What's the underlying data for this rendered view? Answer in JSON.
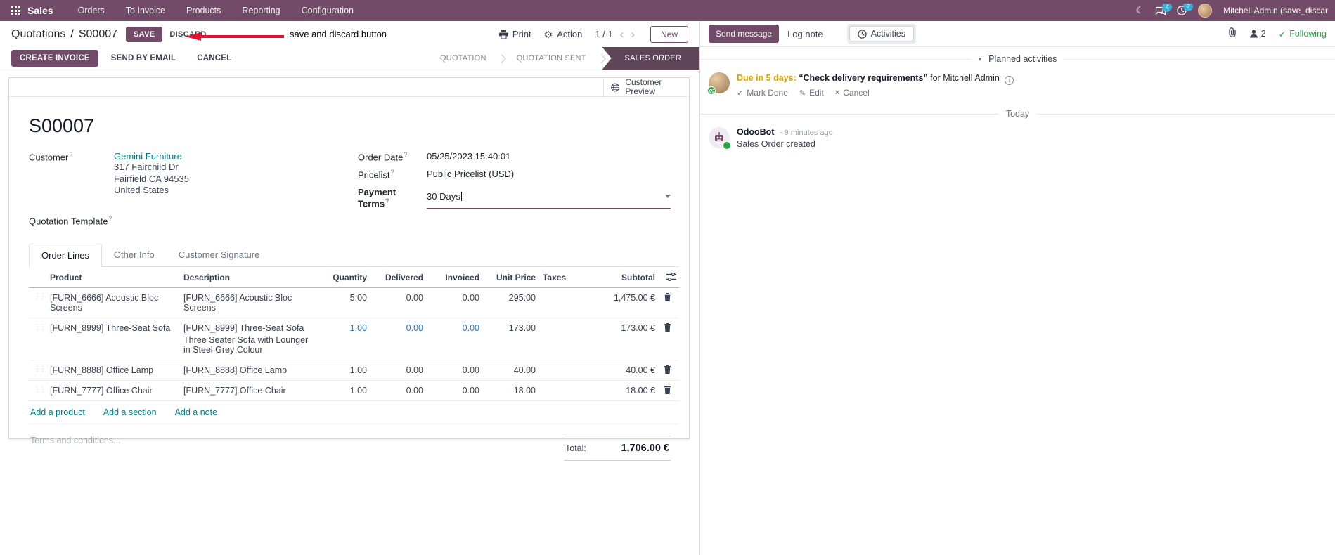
{
  "colors": {
    "brand": "#714B67",
    "link": "#017E84",
    "accent_blue": "#2f6fd0",
    "warning": "#d9a000",
    "success": "#28a745",
    "badge": "#3bb0d8",
    "annotation": "#e8112d",
    "active_step": "#5e4658"
  },
  "nav": {
    "app": "Sales",
    "menus": [
      "Orders",
      "To Invoice",
      "Products",
      "Reporting",
      "Configuration"
    ],
    "messages_badge": "4",
    "activities_badge": "2",
    "user": "Mitchell Admin (save_discar"
  },
  "control": {
    "breadcrumb": "Quotations",
    "separator": "/",
    "record": "S00007",
    "save": "SAVE",
    "discard": "DISCARD",
    "print": "Print",
    "action": "Action",
    "pager": "1 / 1",
    "new": "New"
  },
  "annotation": {
    "label": "save and discard button"
  },
  "statusbar": {
    "create_invoice": "CREATE INVOICE",
    "send_by_email": "SEND BY EMAIL",
    "cancel": "CANCEL",
    "steps": [
      "QUOTATION",
      "QUOTATION SENT",
      "SALES ORDER"
    ],
    "active_step": "SALES ORDER"
  },
  "form": {
    "customer_preview": "Customer Preview",
    "title": "S00007",
    "labels": {
      "customer": "Customer",
      "quotation_template": "Quotation Template",
      "order_date": "Order Date",
      "pricelist": "Pricelist",
      "payment_terms": "Payment Terms"
    },
    "customer": {
      "name": "Gemini Furniture",
      "address1": "317 Fairchild Dr",
      "address2": "Fairfield CA 94535",
      "address3": "United States"
    },
    "order_date": "05/25/2023 15:40:01",
    "pricelist": "Public Pricelist (USD)",
    "payment_terms": "30 Days",
    "tabs": [
      "Order Lines",
      "Other Info",
      "Customer Signature"
    ],
    "active_tab": "Order Lines"
  },
  "lines": {
    "headers": [
      "Product",
      "Description",
      "Quantity",
      "Delivered",
      "Invoiced",
      "Unit Price",
      "Taxes",
      "Subtotal"
    ],
    "rows": [
      {
        "product": "[FURN_6666] Acoustic Bloc Screens",
        "desc": "[FURN_6666] Acoustic Bloc Screens",
        "desc2": "",
        "qty": "5.00",
        "delivered": "0.00",
        "invoiced": "0.00",
        "price": "295.00",
        "subtotal": "1,475.00 €"
      },
      {
        "product": "[FURN_8999] Three-Seat Sofa",
        "desc": "[FURN_8999] Three-Seat Sofa",
        "desc2": "Three Seater Sofa with Lounger in Steel Grey Colour",
        "qty": "1.00",
        "delivered": "0.00",
        "invoiced": "0.00",
        "price": "173.00",
        "subtotal": "173.00 €"
      },
      {
        "product": "[FURN_8888] Office Lamp",
        "desc": "[FURN_8888] Office Lamp",
        "desc2": "",
        "qty": "1.00",
        "delivered": "0.00",
        "invoiced": "0.00",
        "price": "40.00",
        "subtotal": "40.00 €"
      },
      {
        "product": "[FURN_7777] Office Chair",
        "desc": "[FURN_7777] Office Chair",
        "desc2": "",
        "qty": "1.00",
        "delivered": "0.00",
        "invoiced": "0.00",
        "price": "18.00",
        "subtotal": "18.00 €"
      }
    ],
    "add_product": "Add a product",
    "add_section": "Add a section",
    "add_note": "Add a note",
    "terms_placeholder": "Terms and conditions...",
    "total_label": "Total:",
    "total": "1,706.00 €"
  },
  "chatter": {
    "send_message": "Send message",
    "log_note": "Log note",
    "activities_tab": "Activities",
    "followers_count": "2",
    "following": "Following",
    "planned_title": "Planned activities",
    "activity": {
      "due": "Due in 5 days:",
      "summary": "“Check delivery requirements”",
      "for_text": "for Mitchell Admin",
      "mark_done": "Mark Done",
      "edit": "Edit",
      "cancel": "Cancel"
    },
    "today": "Today",
    "message": {
      "author": "OdooBot",
      "time": "- 9 minutes ago",
      "body": "Sales Order created"
    }
  }
}
